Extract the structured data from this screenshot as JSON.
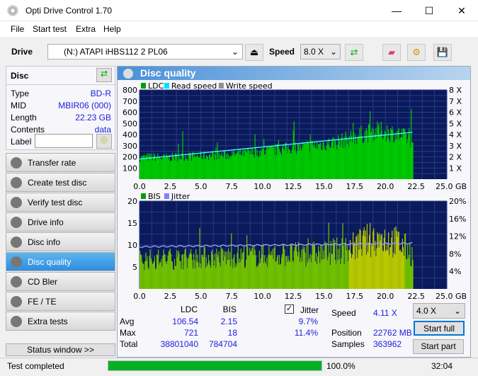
{
  "window": {
    "title": "Opti Drive Control 1.70",
    "minimize": "—",
    "maximize": "☐",
    "close": "✕"
  },
  "menu": [
    "File",
    "Start test",
    "Extra",
    "Help"
  ],
  "toolbar": {
    "drive_label": "Drive",
    "drive_value": "(N:)  ATAPI iHBS112  2 PL06",
    "speed_label": "Speed",
    "speed_value": "8.0 X"
  },
  "disc": {
    "title": "Disc",
    "rows": [
      {
        "k": "Type",
        "v": "BD-R"
      },
      {
        "k": "MID",
        "v": "MBIR06 (000)"
      },
      {
        "k": "Length",
        "v": "22.23 GB"
      },
      {
        "k": "Contents",
        "v": "data"
      }
    ],
    "label_label": "Label",
    "label_value": ""
  },
  "nav": [
    {
      "label": "Transfer rate"
    },
    {
      "label": "Create test disc"
    },
    {
      "label": "Verify test disc"
    },
    {
      "label": "Drive info"
    },
    {
      "label": "Disc info"
    },
    {
      "label": "Disc quality",
      "active": true
    },
    {
      "label": "CD Bler"
    },
    {
      "label": "FE / TE"
    },
    {
      "label": "Extra tests"
    }
  ],
  "status_window": "Status window >>",
  "panel_title": "Disc quality",
  "chart_data": [
    {
      "type": "bar",
      "legend": [
        "LDC",
        "Read speed",
        "Write speed"
      ],
      "legend_colors": [
        "#00a000",
        "#00e0ff",
        "#909090"
      ],
      "x_ticks": [
        "0.0",
        "2.5",
        "5.0",
        "7.5",
        "10.0",
        "12.5",
        "15.0",
        "17.5",
        "20.0",
        "22.5",
        "25.0 GB"
      ],
      "xlim": [
        0,
        25
      ],
      "ylim": [
        0,
        800
      ],
      "y_ticks": [
        "100",
        "200",
        "300",
        "400",
        "500",
        "600",
        "700",
        "800"
      ],
      "y2_ticks": [
        "1 X",
        "2 X",
        "3 X",
        "4 X",
        "5 X",
        "6 X",
        "7 X",
        "8 X"
      ],
      "y2lim": [
        0,
        8
      ],
      "ldc_profile_x": [
        0,
        1,
        2,
        3,
        4,
        5,
        6,
        7,
        8,
        9,
        10,
        11,
        12,
        13,
        14,
        15,
        16,
        17,
        18,
        19,
        20,
        21,
        22,
        22.2
      ],
      "ldc_profile_y": [
        200,
        210,
        200,
        210,
        215,
        220,
        225,
        230,
        240,
        250,
        260,
        275,
        290,
        300,
        315,
        330,
        350,
        380,
        420,
        450,
        450,
        420,
        380,
        300
      ],
      "read_speed": {
        "x": [
          0,
          22.2
        ],
        "y": [
          1.8,
          4.2
        ]
      }
    },
    {
      "type": "bar",
      "legend": [
        "BIS",
        "Jitter"
      ],
      "legend_colors": [
        "#00a000",
        "#8080ff"
      ],
      "x_ticks": [
        "0.0",
        "2.5",
        "5.0",
        "7.5",
        "10.0",
        "12.5",
        "15.0",
        "17.5",
        "20.0",
        "22.5",
        "25.0 GB"
      ],
      "xlim": [
        0,
        25
      ],
      "ylim": [
        0,
        20
      ],
      "y_ticks": [
        "5",
        "10",
        "15",
        "20"
      ],
      "y2_ticks": [
        "4%",
        "8%",
        "12%",
        "16%",
        "20%"
      ],
      "y2lim": [
        0,
        20
      ],
      "bis_profile_x": [
        0,
        5,
        10,
        15,
        17,
        18,
        19,
        20,
        21,
        22,
        22.2
      ],
      "bis_profile_y": [
        7,
        7.5,
        8,
        8.5,
        9.5,
        11,
        12,
        12,
        11,
        9,
        6
      ],
      "jitter": {
        "x": [
          0,
          22.2
        ],
        "y": [
          9.6,
          10.4
        ]
      }
    }
  ],
  "stats": {
    "col_ldc": "LDC",
    "col_bis": "BIS",
    "jitter_label": "Jitter",
    "jitter_checked": true,
    "rows": [
      {
        "k": "Avg",
        "ldc": "106.54",
        "bis": "2.15",
        "jit": "9.7%"
      },
      {
        "k": "Max",
        "ldc": "721",
        "bis": "18",
        "jit": "11.4%"
      },
      {
        "k": "Total",
        "ldc": "38801040",
        "bis": "784704",
        "jit": ""
      }
    ],
    "speed_label": "Speed",
    "speed_value": "4.11 X",
    "position_label": "Position",
    "position_value": "22762 MB",
    "samples_label": "Samples",
    "samples_value": "363962",
    "speed_select": "4.0 X",
    "start_full": "Start full",
    "start_part": "Start part"
  },
  "statusbar": {
    "text": "Test completed",
    "progress": 100,
    "progress_text": "100.0%",
    "time": "32:04"
  }
}
